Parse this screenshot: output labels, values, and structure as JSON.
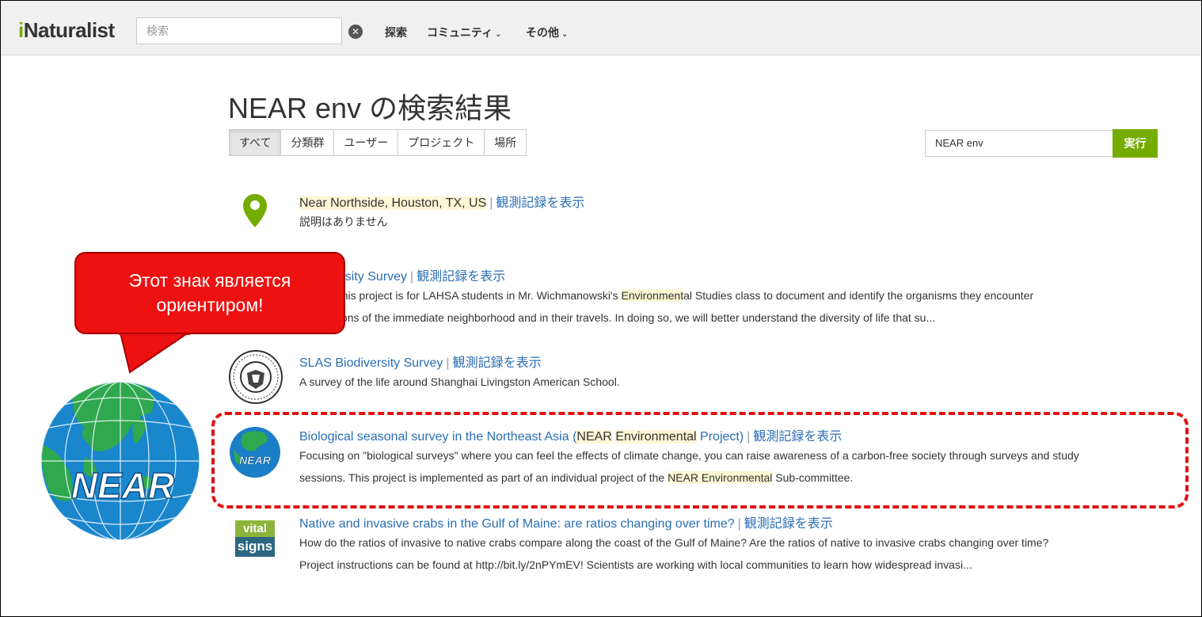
{
  "header": {
    "logo_prefix": "i",
    "logo_rest": "Naturalist",
    "search_placeholder": "検索",
    "nav": [
      {
        "label": "探索",
        "has_chevron": false
      },
      {
        "label": "コミュニティ",
        "has_chevron": true
      },
      {
        "label": "その他",
        "has_chevron": true
      }
    ]
  },
  "page": {
    "title": "NEAR env の検索結果",
    "tabs": [
      "すべて",
      "分類群",
      "ユーザー",
      "プロジェクト",
      "場所"
    ],
    "active_tab": "すべて",
    "search_value": "NEAR env",
    "search_button": "実行"
  },
  "results": [
    {
      "title": "Near Northside, Houston, TX, US",
      "link": "観測記録を表示",
      "desc1": "説明はありません",
      "desc2": ""
    },
    {
      "title": "Biodiversity Survey",
      "link": "観測記録を表示",
      "desc1_a": "pose of this project is for LAHSA students in Mr. Wichmanowski's ",
      "desc1_hl": "Environment",
      "desc1_b": "al Studies class to document and identify the organisms they encounter",
      "desc2": "explorations of the immediate neighborhood and in their travels. In doing so, we will better understand the diversity of life that su..."
    },
    {
      "title": "SLAS Biodiversity Survey",
      "link": "観測記録を表示",
      "desc1": "A survey of the life around Shanghai Livingston American School.",
      "desc2": ""
    },
    {
      "title_a": "Biological seasonal survey in the Northeast Asia (",
      "title_hl1": "NEAR",
      "title_hl2": "Environmental",
      "title_b": " Project)",
      "link": "観測記録を表示",
      "desc1": "Focusing on \"biological surveys\" where you can feel the effects of climate change, you can raise awareness of a carbon-free society through surveys and study",
      "desc2_a": "sessions. This project is implemented as part of an individual project of the ",
      "desc2_hl": "NEAR Environmental",
      "desc2_b": " Sub-committee."
    },
    {
      "title": "Native and invasive crabs in the Gulf of Maine: are ratios changing over time?",
      "link": "観測記録を表示",
      "desc1": "How do the ratios of invasive to native crabs compare along the coast of the Gulf of Maine? Are the ratios of native to invasive crabs changing over time?",
      "desc2": "Project instructions can be found at http://bit.ly/2nPYmEV! Scientists are working with local communities to learn how widespread invasi..."
    }
  ],
  "icons": {
    "vital_line1": "vital",
    "vital_line2": "signs",
    "near_small": "NEAR",
    "near_big": "NEAR"
  },
  "annotation": {
    "line1": "Этот знак является",
    "line2": "ориентиром!"
  },
  "colors": {
    "brand_green": "#74ac00",
    "link_blue": "#2a6eb4",
    "highlight": "#fdf7d6",
    "callout_red": "#ee1111"
  }
}
